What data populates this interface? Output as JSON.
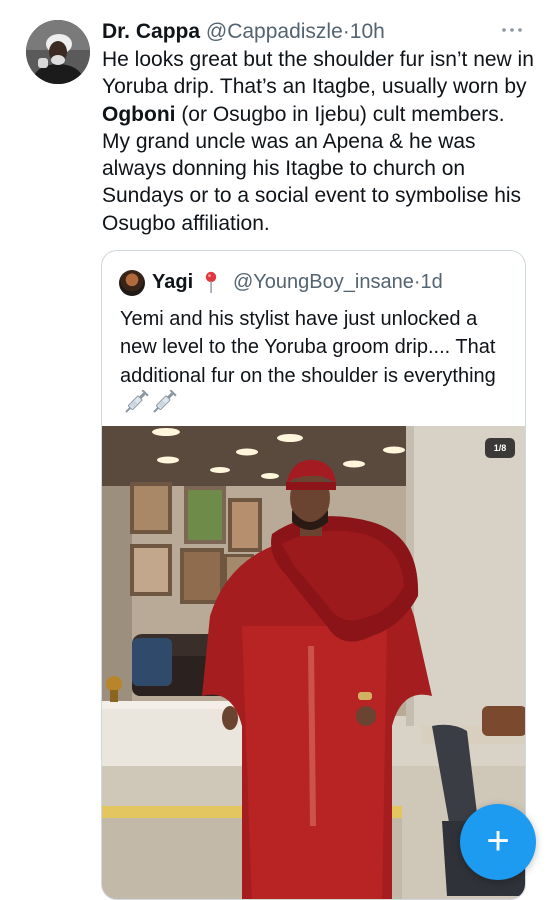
{
  "tweet": {
    "author_name": "Dr. Cappa",
    "author_handle": "@Cappadiszle",
    "separator": "·",
    "time": "10h",
    "text_part1": "He looks great but the shoulder fur isn’t new in Yoruba drip. That’s an Itagbe, usually worn by ",
    "text_bold": "Ogboni",
    "text_part2": " (or Osugbo in Ijebu) cult members. My grand uncle was an Apena & he was always donning his Itagbe to church on Sundays or to a social event to symbolise his Osugbo affiliation."
  },
  "quoted": {
    "author_name": "Yagi",
    "author_handle": "@YoungBoy_insane",
    "separator": "·",
    "time": "1d",
    "text": "Yemi and his stylist have just unlocked a new level to the Yoruba groom drip.... That additional fur on the shoulder is everything",
    "media_counter": "1/8"
  },
  "icons": {
    "more": "more-horizontal-icon",
    "pin": "round-pushpin-icon",
    "syringe": "syringe-icon",
    "compose": "plus-icon"
  },
  "fab": {
    "label": "+"
  },
  "colors": {
    "accent": "#1d9bf0",
    "text": "#0f1419",
    "secondary": "#536471",
    "border": "#cfd9de",
    "agbada_red": "#a51d1f"
  }
}
